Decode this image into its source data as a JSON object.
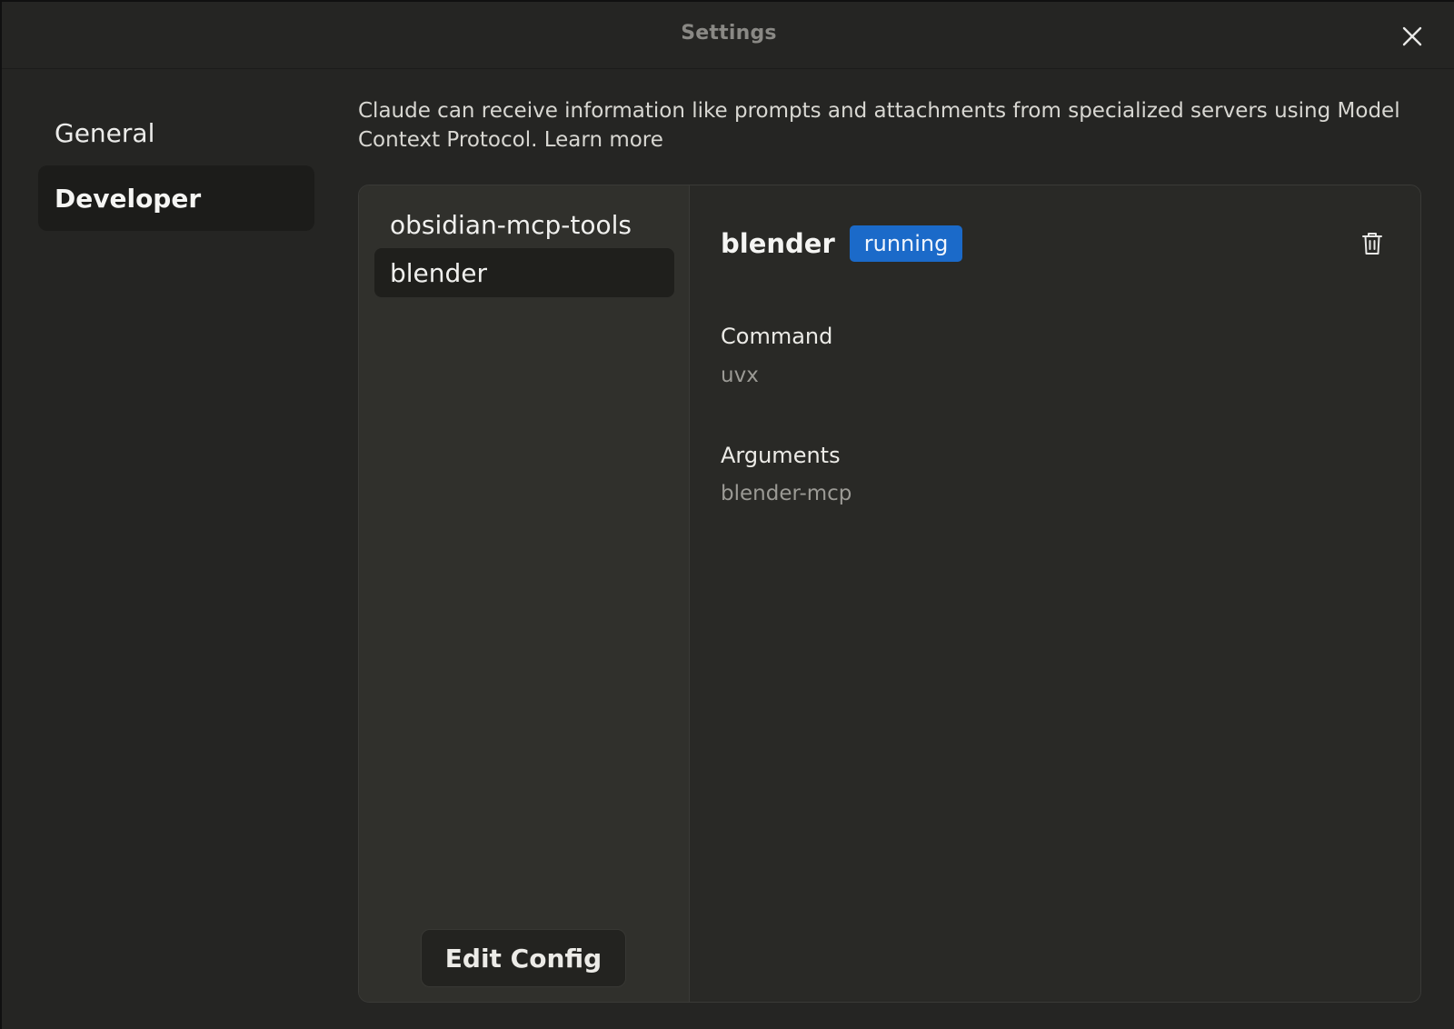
{
  "window": {
    "title": "Settings"
  },
  "nav": {
    "items": [
      {
        "label": "General",
        "active": false
      },
      {
        "label": "Developer",
        "active": true
      }
    ]
  },
  "intro": {
    "text": "Claude can receive information like prompts and attachments from specialized servers using Model Context Protocol.",
    "link_label": "Learn more"
  },
  "servers": {
    "items": [
      {
        "label": "obsidian-mcp-tools",
        "selected": false
      },
      {
        "label": "blender",
        "selected": true
      }
    ],
    "edit_config_label": "Edit Config"
  },
  "detail": {
    "name": "blender",
    "status": "running",
    "status_color": "#1b6ac9",
    "command_label": "Command",
    "command_value": "uvx",
    "arguments_label": "Arguments",
    "arguments_value": "blender-mcp",
    "delete_icon": "trash-icon"
  },
  "colors": {
    "background": "#252523",
    "panel": "#2b2b28",
    "list_bg": "#30302c"
  }
}
